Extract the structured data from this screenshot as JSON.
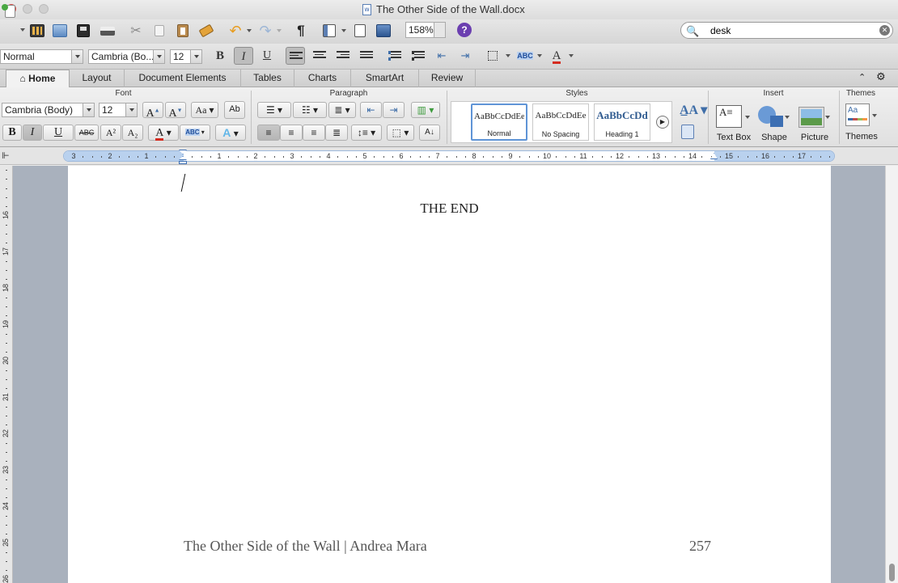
{
  "window": {
    "title": "The Other Side of the Wall.docx"
  },
  "standard_toolbar": {
    "zoom": "158%",
    "search": {
      "value": "desk"
    },
    "help_label": "?"
  },
  "formatting_toolbar": {
    "style": "Normal",
    "font": "Cambria (Bo...",
    "size": "12",
    "bold_label": "B",
    "italic_label": "I",
    "underline_label": "U"
  },
  "ribbon": {
    "tabs": [
      {
        "label": "Home",
        "active": true
      },
      {
        "label": "Layout"
      },
      {
        "label": "Document Elements"
      },
      {
        "label": "Tables"
      },
      {
        "label": "Charts"
      },
      {
        "label": "SmartArt"
      },
      {
        "label": "Review"
      }
    ],
    "groups": {
      "font": "Font",
      "paragraph": "Paragraph",
      "styles": "Styles",
      "insert": "Insert",
      "themes": "Themes"
    },
    "font_group": {
      "font": "Cambria (Body)",
      "size": "12",
      "bold": "B",
      "italic": "I",
      "underline": "U",
      "strike": "ABC",
      "superscript": "A²",
      "subscript": "A₂"
    },
    "styles": [
      {
        "sample": "AaBbCcDdEe",
        "name": "Normal",
        "selected": true
      },
      {
        "sample": "AaBbCcDdEe",
        "name": "No Spacing"
      },
      {
        "sample": "AaBbCcDd",
        "name": "Heading 1"
      }
    ],
    "insert": [
      {
        "label": "Text Box",
        "icon": "text-box-icon"
      },
      {
        "label": "Shape",
        "icon": "shape-icon"
      },
      {
        "label": "Picture",
        "icon": "picture-icon"
      }
    ],
    "themes_button": "Themes"
  },
  "ruler": {
    "labels": [
      "3",
      "2",
      "1",
      "1",
      "2",
      "3",
      "4",
      "5",
      "6",
      "7",
      "8",
      "9",
      "10",
      "11",
      "12",
      "13",
      "14",
      "15",
      "16",
      "17"
    ]
  },
  "vertical_ruler": {
    "labels": [
      "16",
      "17",
      "18",
      "19",
      "20",
      "21",
      "22",
      "23",
      "24",
      "25",
      "26"
    ]
  },
  "document": {
    "body_text": "THE END",
    "footer_title": "The Other Side of the Wall | Andrea Mara",
    "footer_page": "257"
  },
  "colors": {
    "accent": "#5f94d6",
    "close_red": "#fc605c",
    "canvas": "#a9b1bd"
  }
}
